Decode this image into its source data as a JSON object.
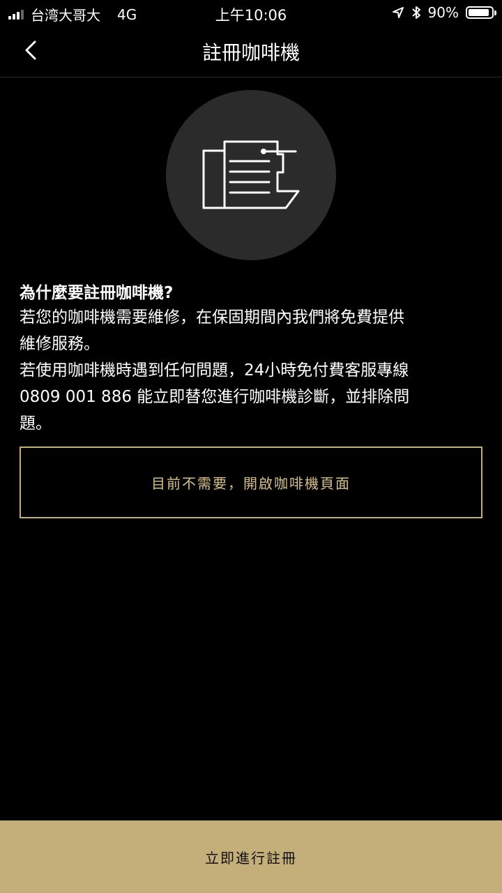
{
  "status_bar": {
    "carrier": "台湾大哥大",
    "network": "4G",
    "time": "上午10:06",
    "battery_percent": "90%",
    "battery_level": 0.9,
    "icons": [
      "signal-icon",
      "location-icon",
      "bluetooth-icon",
      "battery-icon"
    ]
  },
  "nav": {
    "back_icon": "chevron-left-icon",
    "title": "註冊咖啡機"
  },
  "illustration": {
    "icon": "coffee-machine-icon"
  },
  "content": {
    "question": "為什麼要註冊咖啡機?",
    "lines": [
      "若您的咖啡機需要維修，在保固期間內我們將免費提供",
      "維修服務。",
      "若使用咖啡機時遇到任何問題，24小時免付費客服專線",
      "0809 001 886 能立即替您進行咖啡機診斷，並排除問",
      "題。"
    ]
  },
  "buttons": {
    "skip_label": "目前不需要，開啟咖啡機頁面",
    "register_label": "立即進行註冊"
  },
  "colors": {
    "accent": "#c4ae7a",
    "accent_text": "#d7c08b",
    "background": "#000000",
    "circle": "#2b2b2b"
  }
}
